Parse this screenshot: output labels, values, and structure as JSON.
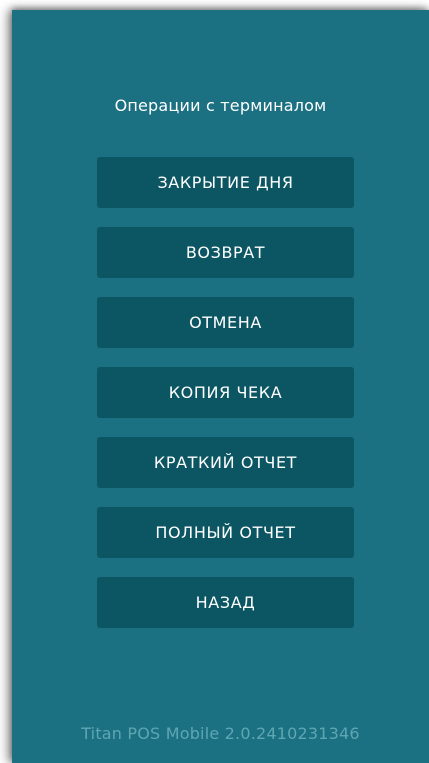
{
  "screen": {
    "title": "Операции с терминалом",
    "version": "Titan POS Mobile 2.0.2410231346"
  },
  "menu": {
    "items": [
      {
        "label": "ЗАКРЫТИЕ ДНЯ"
      },
      {
        "label": "ВОЗВРАТ"
      },
      {
        "label": "ОТМЕНА"
      },
      {
        "label": "КОПИЯ ЧЕКА"
      },
      {
        "label": "КРАТКИЙ ОТЧЕТ"
      },
      {
        "label": "ПОЛНЫЙ ОТЧЕТ"
      },
      {
        "label": "НАЗАД"
      }
    ]
  },
  "colors": {
    "background": "#1b7182",
    "button": "#0c5663",
    "version_text": "#5fa6b3"
  }
}
